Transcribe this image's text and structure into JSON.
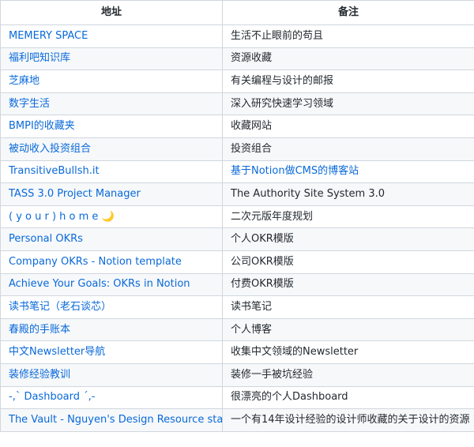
{
  "table": {
    "headers": [
      "地址",
      "备注"
    ],
    "rows": [
      {
        "name": "MEMERY SPACE",
        "note": "生活不止眼前的苟且",
        "note_is_link": false
      },
      {
        "name": "福利吧知识库",
        "note": "资源收藏",
        "note_is_link": false
      },
      {
        "name": "芝麻地",
        "note": "有关编程与设计的邮报",
        "note_is_link": false
      },
      {
        "name": "数字生活",
        "note": "深入研究快速学习领域",
        "note_is_link": false
      },
      {
        "name": "BMPI的收藏夹",
        "note": "收藏网站",
        "note_is_link": false
      },
      {
        "name": "被动收入投资组合",
        "note": "投资组合",
        "note_is_link": false
      },
      {
        "name": "TransitiveBullsh.it",
        "note": "基于Notion做CMS的博客站",
        "note_is_link": true
      },
      {
        "name": "TASS 3.0 Project Manager",
        "note": "The Authority Site System 3.0",
        "note_is_link": false
      },
      {
        "name": "( y o u r ) h o m e 🌙",
        "note": "二次元版年度规划",
        "note_is_link": false
      },
      {
        "name": "Personal OKRs",
        "note": "个人OKR模版",
        "note_is_link": false
      },
      {
        "name": "Company OKRs - Notion template",
        "note": "公司OKR模版",
        "note_is_link": false
      },
      {
        "name": "Achieve Your Goals: OKRs in Notion",
        "note": "付费OKR模版",
        "note_is_link": false
      },
      {
        "name": "读书笔记（老石谈芯）",
        "note": "读书笔记",
        "note_is_link": false
      },
      {
        "name": "春殿的手账本",
        "note": "个人博客",
        "note_is_link": false
      },
      {
        "name": "中文Newsletter导航",
        "note": "收集中文领域的Newsletter",
        "note_is_link": false
      },
      {
        "name": "装修经验教训",
        "note": "装修一手被坑经验",
        "note_is_link": false
      },
      {
        "name": "-,` Dashboard ´,-",
        "note": "很漂亮的个人Dashboard",
        "note_is_link": false
      },
      {
        "name": "The Vault - Nguyen's Design Resource stash",
        "note": "一个有14年设计经验的设计师收藏的关于设计的资源",
        "note_is_link": false
      }
    ]
  },
  "colors": {
    "link": "#0969da",
    "text": "#24292f",
    "border": "#d0d7de",
    "stripe": "#f6f8fa"
  }
}
